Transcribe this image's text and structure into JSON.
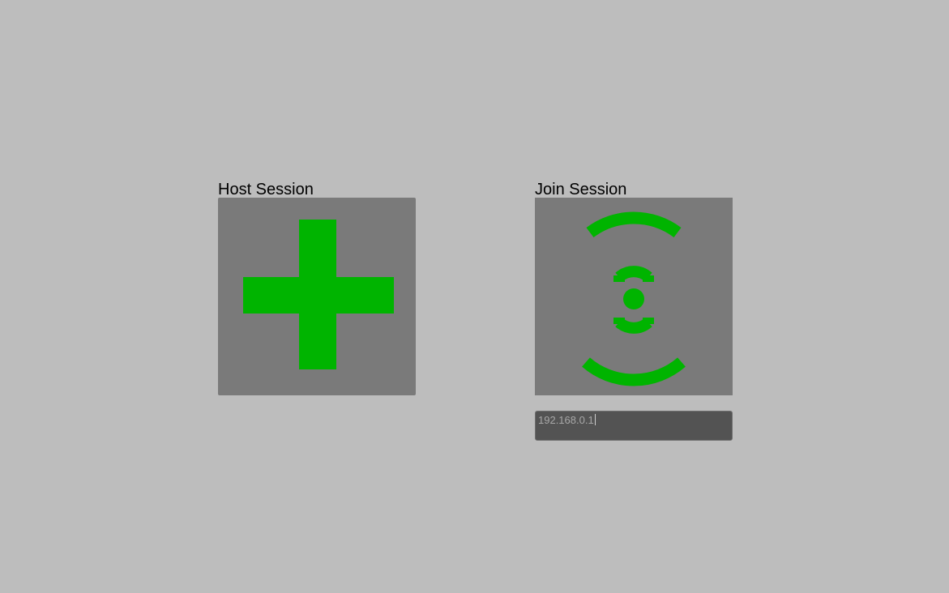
{
  "host": {
    "label": "Host Session",
    "icon": "plus-icon",
    "icon_color": "#00b400",
    "tile_color": "#7a7a7a"
  },
  "join": {
    "label": "Join Session",
    "icon": "broadcast-signal-icon",
    "icon_color": "#00b400",
    "tile_color": "#7a7a7a",
    "address_value": "192.168.0.1"
  },
  "colors": {
    "background": "#bdbdbd",
    "accent": "#00b400",
    "field_background": "#535353"
  }
}
